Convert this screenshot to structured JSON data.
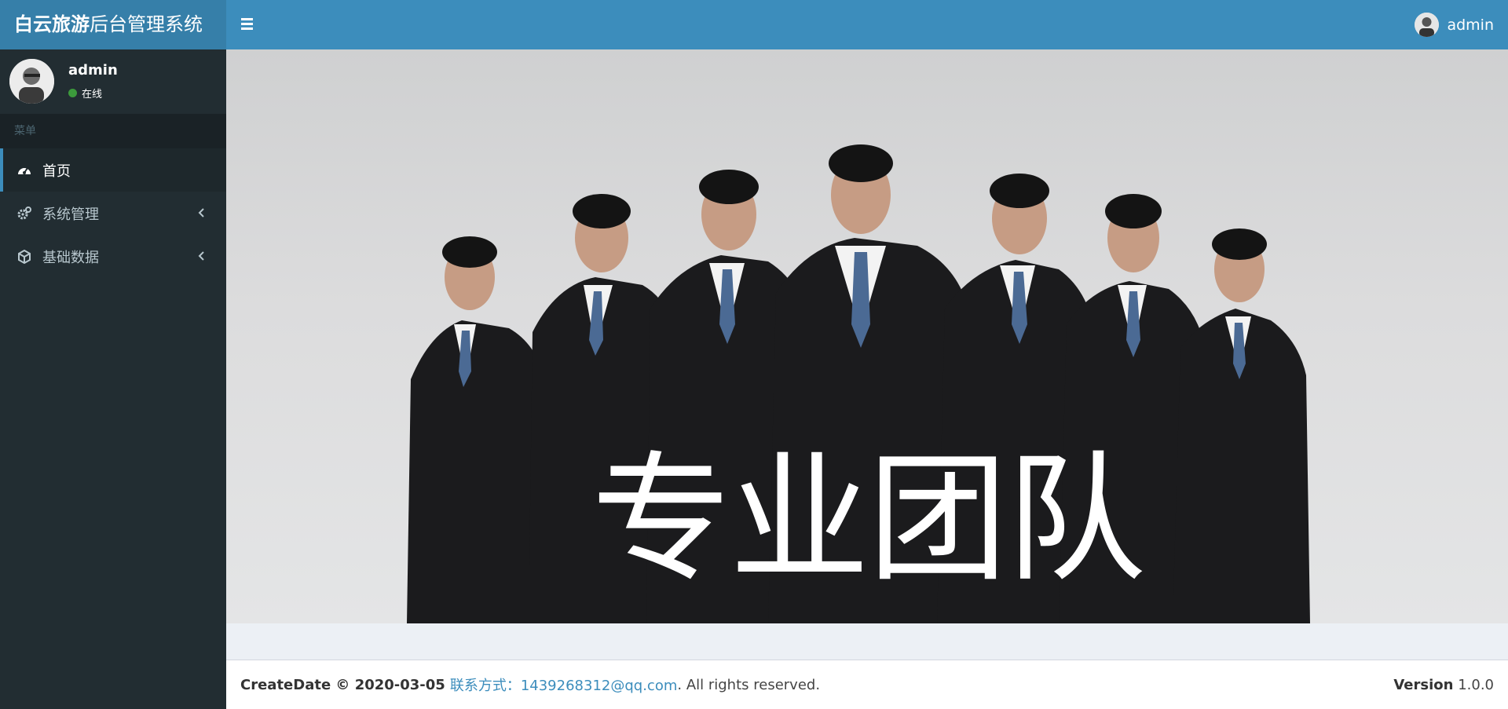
{
  "header": {
    "logo_bold": "白云旅游",
    "logo_rest": "后台管理系统",
    "user_name": "admin"
  },
  "sidebar": {
    "user_name": "admin",
    "status": "在线",
    "menu_header": "菜单",
    "items": [
      {
        "label": "首页",
        "icon": "dashboard-icon"
      },
      {
        "label": "系统管理",
        "icon": "gears-icon"
      },
      {
        "label": "基础数据",
        "icon": "cube-icon"
      }
    ]
  },
  "hero": {
    "text": "专业团队"
  },
  "footer": {
    "create_label": "CreateDate © 2020-03-05",
    "contact": "联系方式：1439268312@qq.com",
    "rights": ". All rights reserved.",
    "version_label": "Version",
    "version_value": "1.0.0"
  },
  "colors": {
    "header_bg": "#3c8dbc",
    "logo_bg": "#367fa9",
    "sidebar_bg": "#222d32",
    "online": "#3c9a3c"
  }
}
